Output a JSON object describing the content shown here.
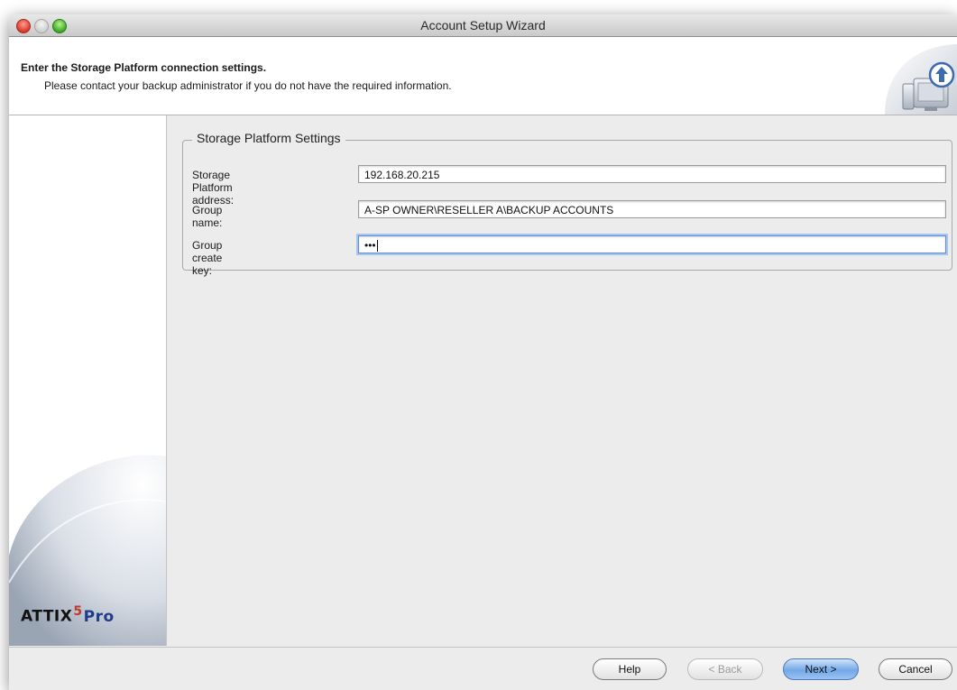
{
  "window": {
    "title": "Account Setup Wizard"
  },
  "header": {
    "title": "Enter the Storage Platform connection settings.",
    "subtitle": "Please contact your backup administrator if you do not have the required information."
  },
  "sidebar": {
    "logo_main": "ATTIX",
    "logo_number": "5",
    "logo_suffix": "Pro"
  },
  "settings": {
    "legend": "Storage Platform Settings",
    "fields": [
      {
        "label": "Storage Platform address:",
        "value": "192.168.20.215"
      },
      {
        "label": "Group name:",
        "value": "A-SP OWNER\\RESELLER A\\BACKUP ACCOUNTS"
      },
      {
        "label": "Group create key:",
        "value": "•••"
      }
    ]
  },
  "buttons": {
    "help": "Help",
    "back": "< Back",
    "next": "Next >",
    "cancel": "Cancel"
  },
  "colors": {
    "default_button": "#73a8e8",
    "focus_ring": "#a7c5ef",
    "logo_pro": "#1e3c8c"
  }
}
